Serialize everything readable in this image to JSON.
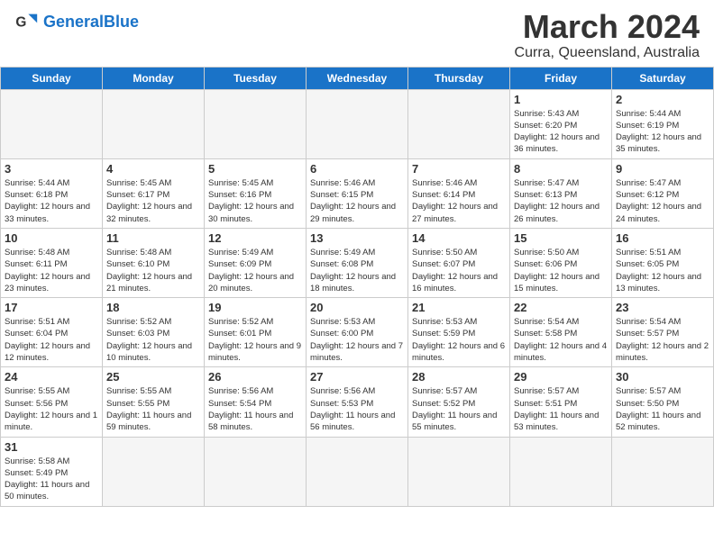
{
  "header": {
    "logo_general": "General",
    "logo_blue": "Blue",
    "month": "March 2024",
    "location": "Curra, Queensland, Australia"
  },
  "weekdays": [
    "Sunday",
    "Monday",
    "Tuesday",
    "Wednesday",
    "Thursday",
    "Friday",
    "Saturday"
  ],
  "weeks": [
    [
      {
        "day": "",
        "info": ""
      },
      {
        "day": "",
        "info": ""
      },
      {
        "day": "",
        "info": ""
      },
      {
        "day": "",
        "info": ""
      },
      {
        "day": "",
        "info": ""
      },
      {
        "day": "1",
        "info": "Sunrise: 5:43 AM\nSunset: 6:20 PM\nDaylight: 12 hours and 36 minutes."
      },
      {
        "day": "2",
        "info": "Sunrise: 5:44 AM\nSunset: 6:19 PM\nDaylight: 12 hours and 35 minutes."
      }
    ],
    [
      {
        "day": "3",
        "info": "Sunrise: 5:44 AM\nSunset: 6:18 PM\nDaylight: 12 hours and 33 minutes."
      },
      {
        "day": "4",
        "info": "Sunrise: 5:45 AM\nSunset: 6:17 PM\nDaylight: 12 hours and 32 minutes."
      },
      {
        "day": "5",
        "info": "Sunrise: 5:45 AM\nSunset: 6:16 PM\nDaylight: 12 hours and 30 minutes."
      },
      {
        "day": "6",
        "info": "Sunrise: 5:46 AM\nSunset: 6:15 PM\nDaylight: 12 hours and 29 minutes."
      },
      {
        "day": "7",
        "info": "Sunrise: 5:46 AM\nSunset: 6:14 PM\nDaylight: 12 hours and 27 minutes."
      },
      {
        "day": "8",
        "info": "Sunrise: 5:47 AM\nSunset: 6:13 PM\nDaylight: 12 hours and 26 minutes."
      },
      {
        "day": "9",
        "info": "Sunrise: 5:47 AM\nSunset: 6:12 PM\nDaylight: 12 hours and 24 minutes."
      }
    ],
    [
      {
        "day": "10",
        "info": "Sunrise: 5:48 AM\nSunset: 6:11 PM\nDaylight: 12 hours and 23 minutes."
      },
      {
        "day": "11",
        "info": "Sunrise: 5:48 AM\nSunset: 6:10 PM\nDaylight: 12 hours and 21 minutes."
      },
      {
        "day": "12",
        "info": "Sunrise: 5:49 AM\nSunset: 6:09 PM\nDaylight: 12 hours and 20 minutes."
      },
      {
        "day": "13",
        "info": "Sunrise: 5:49 AM\nSunset: 6:08 PM\nDaylight: 12 hours and 18 minutes."
      },
      {
        "day": "14",
        "info": "Sunrise: 5:50 AM\nSunset: 6:07 PM\nDaylight: 12 hours and 16 minutes."
      },
      {
        "day": "15",
        "info": "Sunrise: 5:50 AM\nSunset: 6:06 PM\nDaylight: 12 hours and 15 minutes."
      },
      {
        "day": "16",
        "info": "Sunrise: 5:51 AM\nSunset: 6:05 PM\nDaylight: 12 hours and 13 minutes."
      }
    ],
    [
      {
        "day": "17",
        "info": "Sunrise: 5:51 AM\nSunset: 6:04 PM\nDaylight: 12 hours and 12 minutes."
      },
      {
        "day": "18",
        "info": "Sunrise: 5:52 AM\nSunset: 6:03 PM\nDaylight: 12 hours and 10 minutes."
      },
      {
        "day": "19",
        "info": "Sunrise: 5:52 AM\nSunset: 6:01 PM\nDaylight: 12 hours and 9 minutes."
      },
      {
        "day": "20",
        "info": "Sunrise: 5:53 AM\nSunset: 6:00 PM\nDaylight: 12 hours and 7 minutes."
      },
      {
        "day": "21",
        "info": "Sunrise: 5:53 AM\nSunset: 5:59 PM\nDaylight: 12 hours and 6 minutes."
      },
      {
        "day": "22",
        "info": "Sunrise: 5:54 AM\nSunset: 5:58 PM\nDaylight: 12 hours and 4 minutes."
      },
      {
        "day": "23",
        "info": "Sunrise: 5:54 AM\nSunset: 5:57 PM\nDaylight: 12 hours and 2 minutes."
      }
    ],
    [
      {
        "day": "24",
        "info": "Sunrise: 5:55 AM\nSunset: 5:56 PM\nDaylight: 12 hours and 1 minute."
      },
      {
        "day": "25",
        "info": "Sunrise: 5:55 AM\nSunset: 5:55 PM\nDaylight: 11 hours and 59 minutes."
      },
      {
        "day": "26",
        "info": "Sunrise: 5:56 AM\nSunset: 5:54 PM\nDaylight: 11 hours and 58 minutes."
      },
      {
        "day": "27",
        "info": "Sunrise: 5:56 AM\nSunset: 5:53 PM\nDaylight: 11 hours and 56 minutes."
      },
      {
        "day": "28",
        "info": "Sunrise: 5:57 AM\nSunset: 5:52 PM\nDaylight: 11 hours and 55 minutes."
      },
      {
        "day": "29",
        "info": "Sunrise: 5:57 AM\nSunset: 5:51 PM\nDaylight: 11 hours and 53 minutes."
      },
      {
        "day": "30",
        "info": "Sunrise: 5:57 AM\nSunset: 5:50 PM\nDaylight: 11 hours and 52 minutes."
      }
    ],
    [
      {
        "day": "31",
        "info": "Sunrise: 5:58 AM\nSunset: 5:49 PM\nDaylight: 11 hours and 50 minutes."
      },
      {
        "day": "",
        "info": ""
      },
      {
        "day": "",
        "info": ""
      },
      {
        "day": "",
        "info": ""
      },
      {
        "day": "",
        "info": ""
      },
      {
        "day": "",
        "info": ""
      },
      {
        "day": "",
        "info": ""
      }
    ]
  ]
}
